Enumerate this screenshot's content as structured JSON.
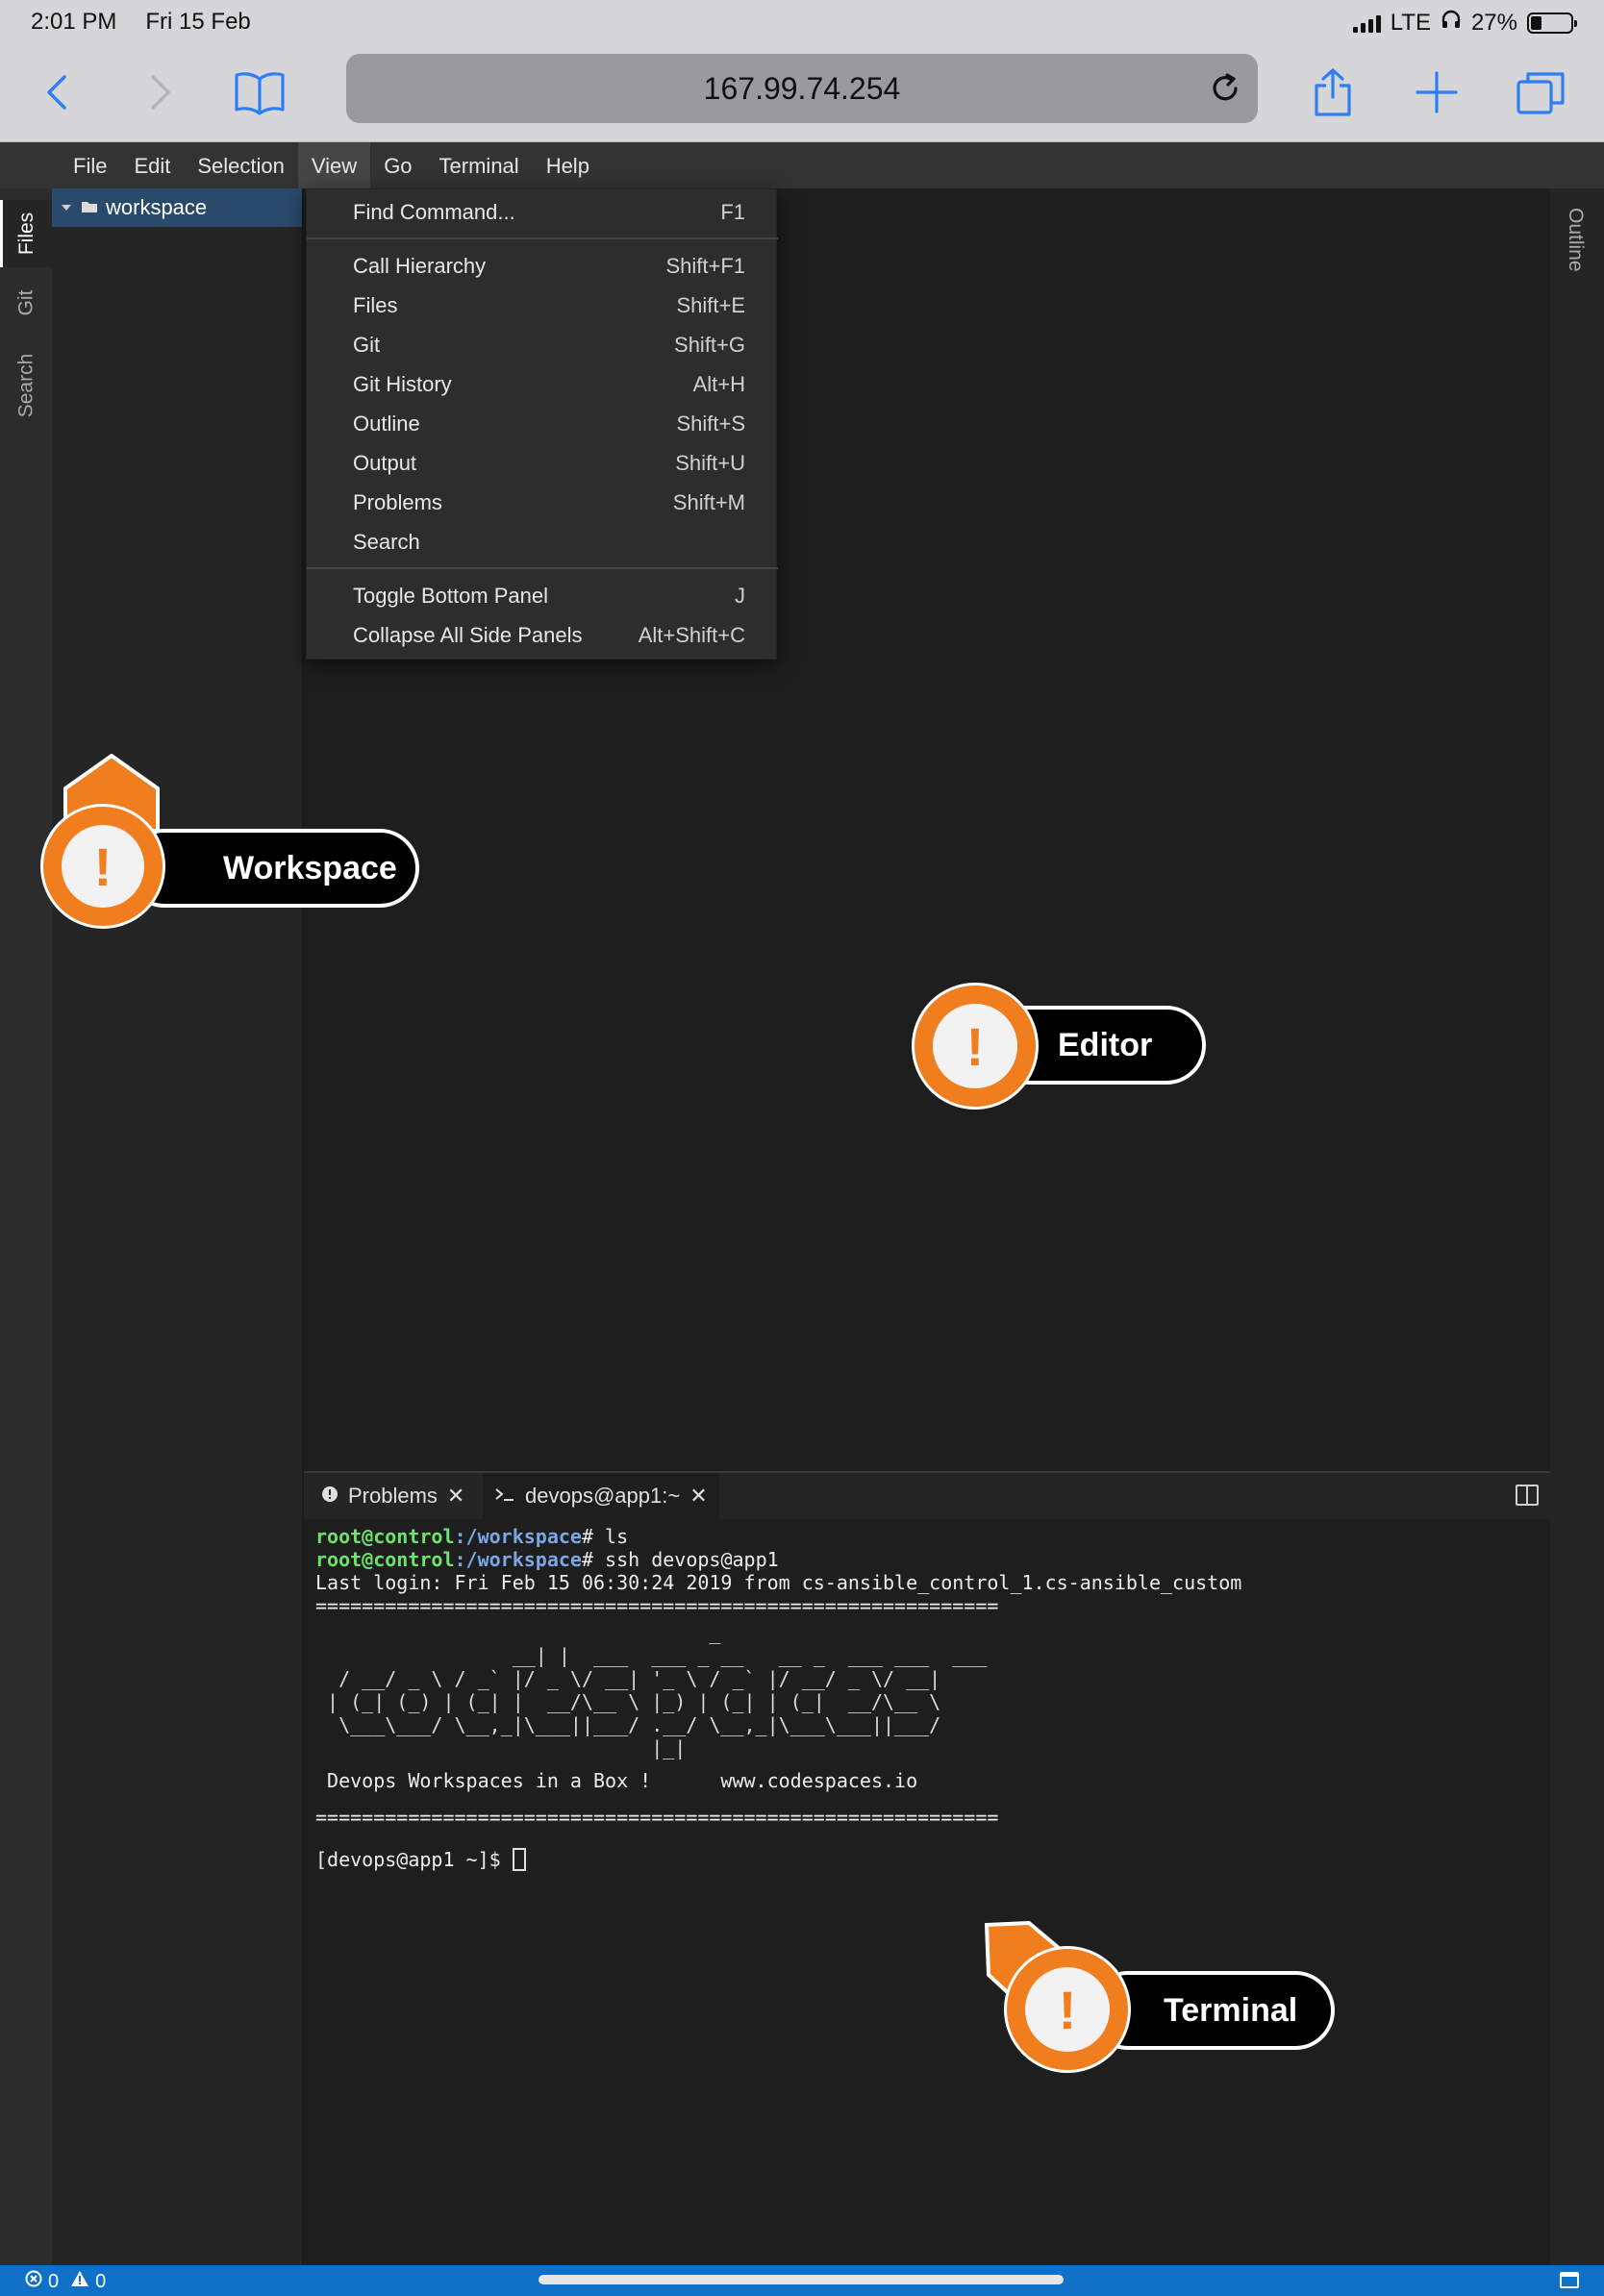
{
  "status_bar": {
    "time": "2:01 PM",
    "date": "Fri 15 Feb",
    "network": "LTE",
    "battery_percent_label": "27%",
    "battery_level": 0.27
  },
  "browser": {
    "url": "167.99.74.254",
    "icons": [
      "back-icon",
      "forward-icon",
      "bookmarks-icon",
      "reload-icon",
      "share-icon",
      "new-tab-icon",
      "tabs-icon"
    ],
    "accent_color": "#2f7ef5"
  },
  "menubar": {
    "items": [
      "File",
      "Edit",
      "Selection",
      "View",
      "Go",
      "Terminal",
      "Help"
    ],
    "active": "View"
  },
  "activity_bar": {
    "tabs": [
      "Files",
      "Git",
      "Search"
    ],
    "active": "Files"
  },
  "right_bar": {
    "label": "Outline"
  },
  "explorer": {
    "root_folder": "workspace"
  },
  "view_menu": {
    "groups": [
      [
        {
          "label": "Find Command...",
          "shortcut": "F1"
        }
      ],
      [
        {
          "label": "Call Hierarchy",
          "shortcut": "Shift+F1"
        },
        {
          "label": "Files",
          "shortcut": "Shift+E"
        },
        {
          "label": "Git",
          "shortcut": "Shift+G"
        },
        {
          "label": "Git History",
          "shortcut": "Alt+H"
        },
        {
          "label": "Outline",
          "shortcut": "Shift+S"
        },
        {
          "label": "Output",
          "shortcut": "Shift+U"
        },
        {
          "label": "Problems",
          "shortcut": "Shift+M"
        },
        {
          "label": "Search",
          "shortcut": ""
        }
      ],
      [
        {
          "label": "Toggle Bottom Panel",
          "shortcut": "J"
        },
        {
          "label": "Collapse All Side Panels",
          "shortcut": "Alt+Shift+C"
        }
      ]
    ]
  },
  "panel": {
    "tabs": [
      {
        "label": "Problems",
        "icon": "info-icon"
      },
      {
        "label": "devops@app1:~",
        "icon": "terminal-icon"
      }
    ]
  },
  "terminal": {
    "line1": {
      "user": "root@control",
      "path": ":/workspace",
      "cmd": "# ls"
    },
    "line2": {
      "user": "root@control",
      "path": ":/workspace",
      "cmd": "# ssh devops@app1"
    },
    "line3": "Last login: Fri Feb 15 06:30:24 2019 from cs-ansible_control_1.cs-ansible_custom",
    "rule": "===========================================================",
    "ascii_art": "                                  _\n                 __| |  ___  ___ _ __   __ _  ___ ___  ___\n  / __/ _ \\ / _` |/ _ \\/ __| '_ \\ / _` |/ __/ _ \\/ __|\n | (_| (_) | (_| |  __/\\__ \\ |_) | (_| | (_|  __/\\__ \\\n  \\___\\___/ \\__,_|\\___||___/ .__/ \\__,_|\\___\\___||___/\n                             |_|",
    "tagline": " Devops Workspaces in a Box !      www.codespaces.io",
    "prompt": "[devops@app1 ~]$ "
  },
  "ide_status": {
    "errors": "0",
    "warnings": "0"
  },
  "callouts": {
    "workspace": "Workspace",
    "editor": "Editor",
    "terminal": "Terminal",
    "color": "#f07d1e"
  }
}
